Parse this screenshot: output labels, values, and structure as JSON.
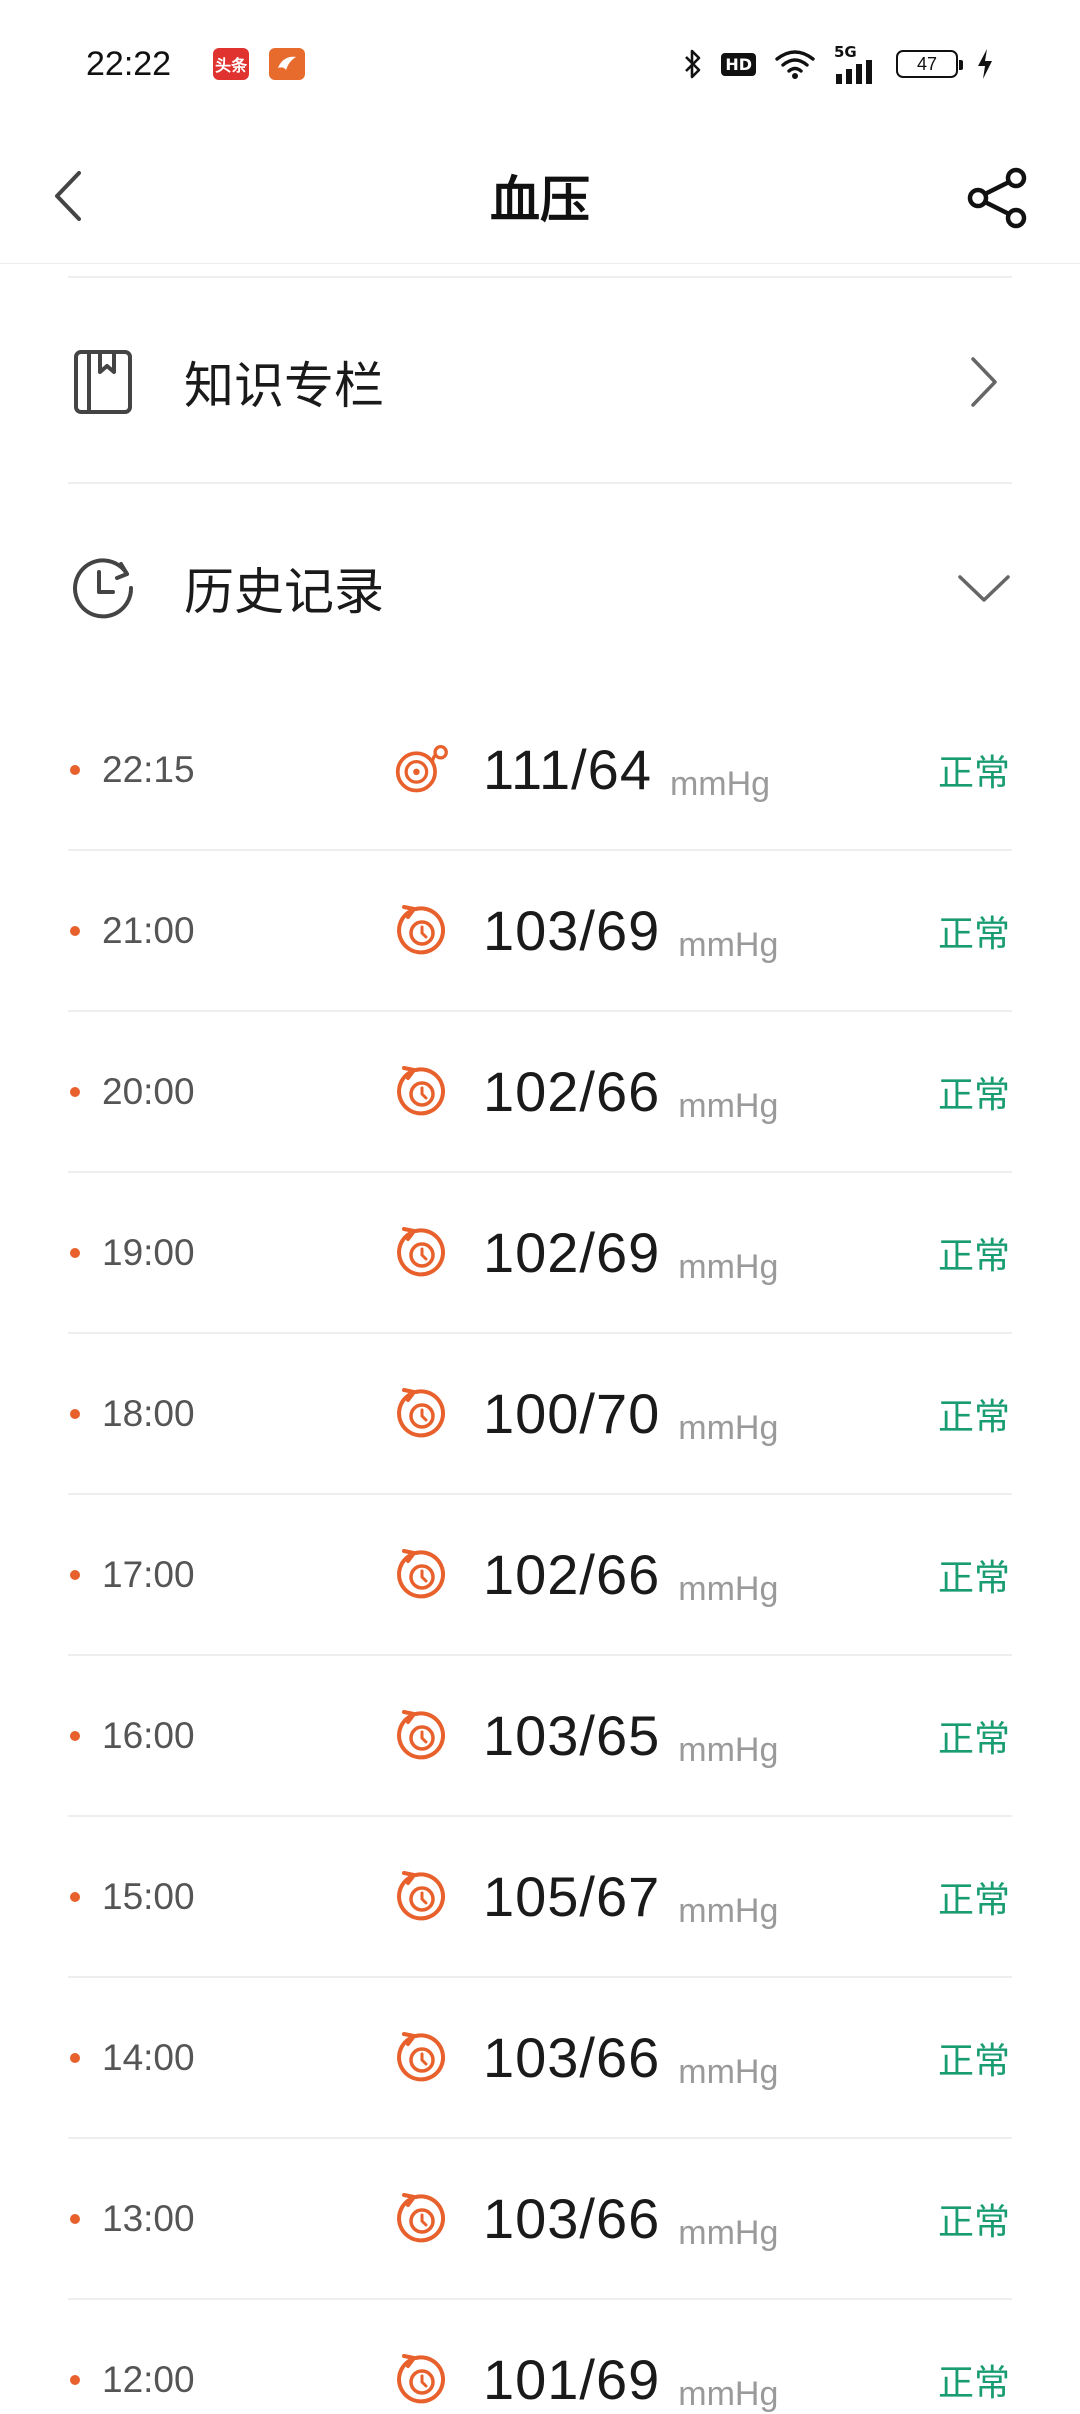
{
  "status_bar": {
    "time": "22:22",
    "app1_label": "头条",
    "app1_color": "#e0322f",
    "app2_icon": "bird-app-icon",
    "app2_color": "#e86b2e",
    "hd_label": "HD",
    "network": "5G",
    "battery": "47",
    "icons": [
      "bluetooth-icon",
      "hd-icon",
      "wifi-icon",
      "signal-5g-icon",
      "battery-icon",
      "charging-icon"
    ]
  },
  "header": {
    "title": "血压",
    "back_icon": "chevron-left-icon",
    "share_icon": "share-icon"
  },
  "sections": {
    "knowledge": {
      "label": "知识专栏",
      "icon": "book-icon",
      "action_icon": "chevron-right-icon"
    },
    "history": {
      "label": "历史记录",
      "icon": "clock-icon",
      "action_icon": "chevron-down-icon"
    }
  },
  "colors": {
    "accent": "#e8612c",
    "status_normal": "#1a9c72",
    "unit_gray": "#9a9a9a"
  },
  "records": [
    {
      "time": "22:15",
      "value": "111/64",
      "unit": "mmHg",
      "status": "正常",
      "source_icon": "manual-measure-icon"
    },
    {
      "time": "21:00",
      "value": "103/69",
      "unit": "mmHg",
      "status": "正常",
      "source_icon": "auto-measure-icon"
    },
    {
      "time": "20:00",
      "value": "102/66",
      "unit": "mmHg",
      "status": "正常",
      "source_icon": "auto-measure-icon"
    },
    {
      "time": "19:00",
      "value": "102/69",
      "unit": "mmHg",
      "status": "正常",
      "source_icon": "auto-measure-icon"
    },
    {
      "time": "18:00",
      "value": "100/70",
      "unit": "mmHg",
      "status": "正常",
      "source_icon": "auto-measure-icon"
    },
    {
      "time": "17:00",
      "value": "102/66",
      "unit": "mmHg",
      "status": "正常",
      "source_icon": "auto-measure-icon"
    },
    {
      "time": "16:00",
      "value": "103/65",
      "unit": "mmHg",
      "status": "正常",
      "source_icon": "auto-measure-icon"
    },
    {
      "time": "15:00",
      "value": "105/67",
      "unit": "mmHg",
      "status": "正常",
      "source_icon": "auto-measure-icon"
    },
    {
      "time": "14:00",
      "value": "103/66",
      "unit": "mmHg",
      "status": "正常",
      "source_icon": "auto-measure-icon"
    },
    {
      "time": "13:00",
      "value": "103/66",
      "unit": "mmHg",
      "status": "正常",
      "source_icon": "auto-measure-icon"
    },
    {
      "time": "12:00",
      "value": "101/69",
      "unit": "mmHg",
      "status": "正常",
      "source_icon": "auto-measure-icon"
    }
  ]
}
